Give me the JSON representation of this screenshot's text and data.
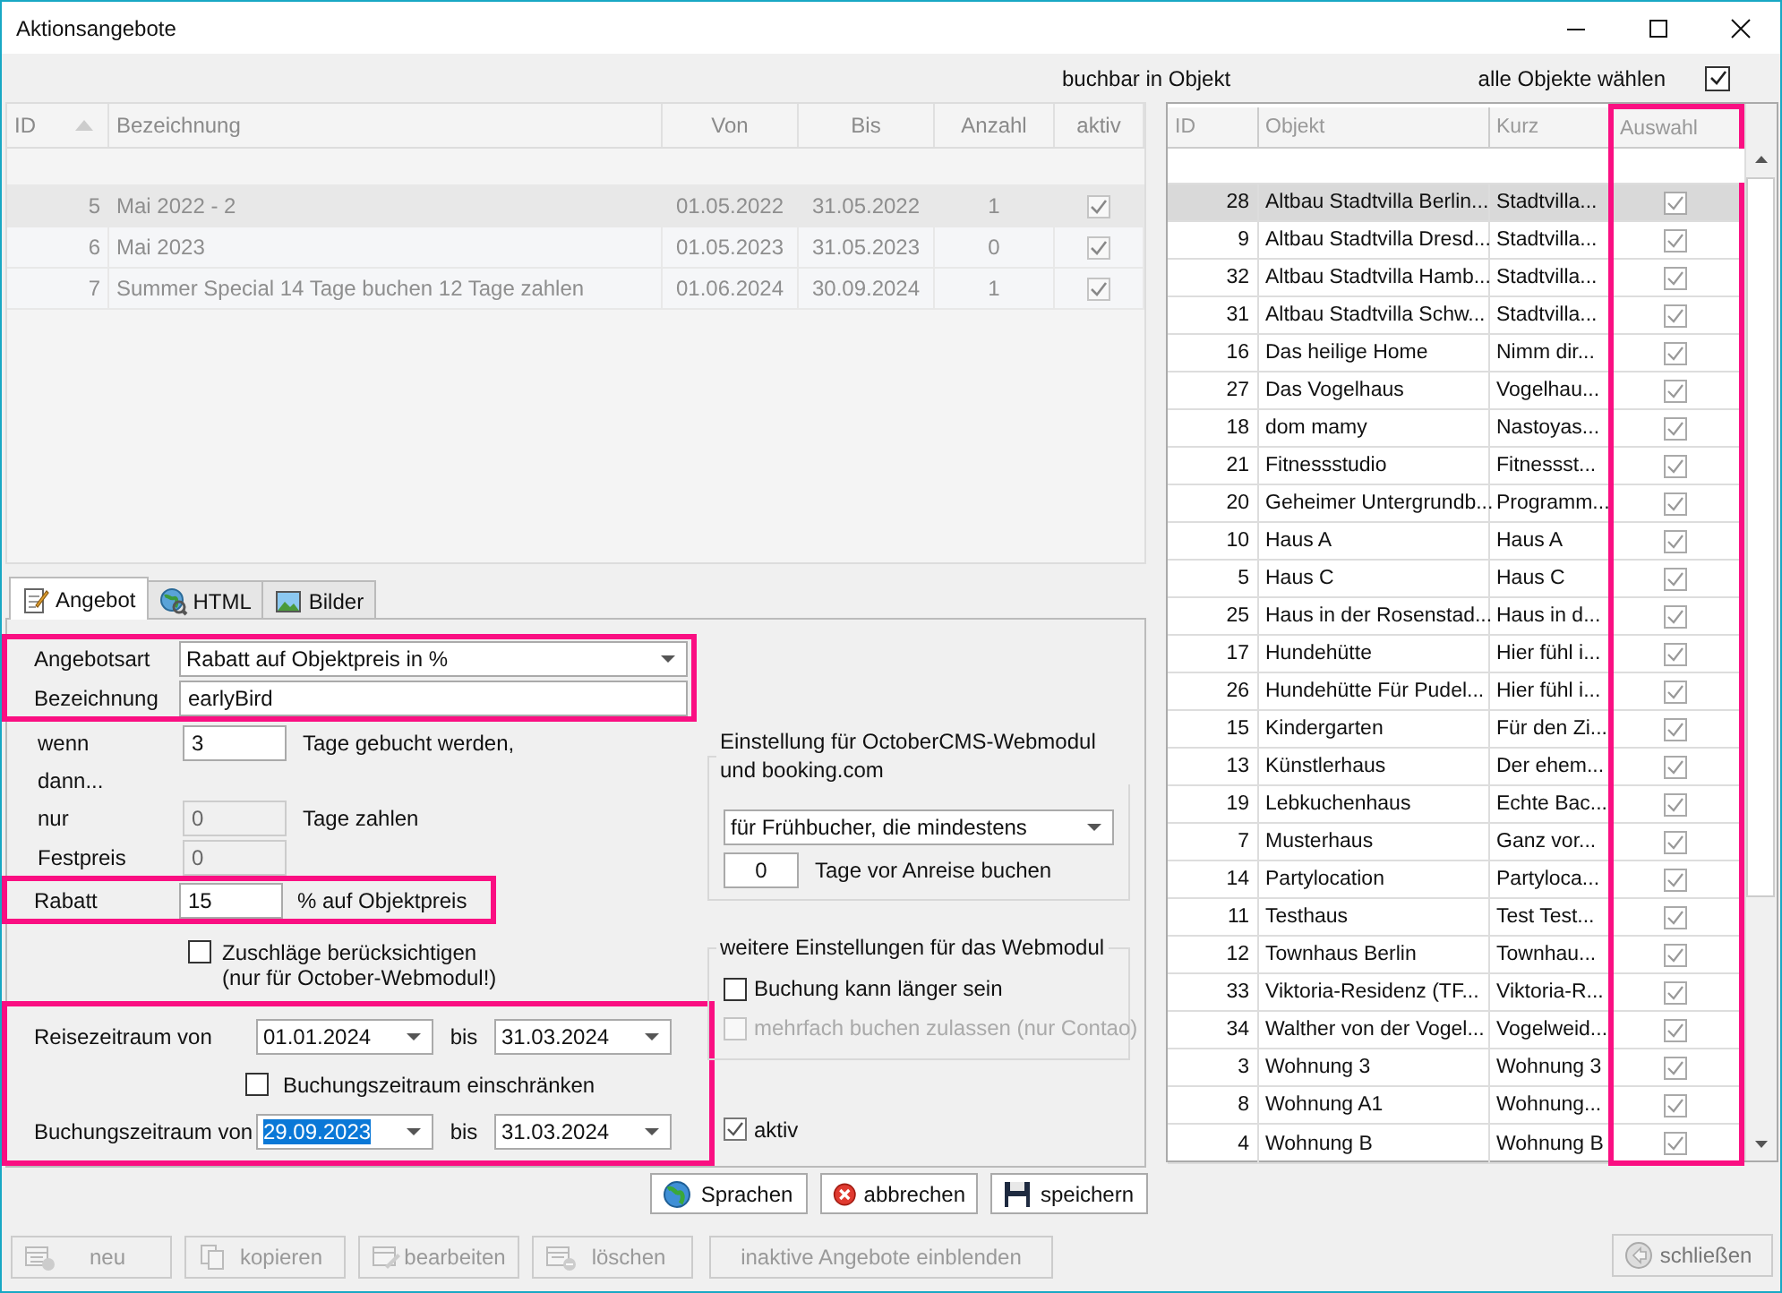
{
  "window": {
    "title": "Aktionsangebote"
  },
  "header": {
    "bookable_label": "buchbar in Objekt",
    "select_all": {
      "label": "alle Objekte wählen",
      "checked": true
    }
  },
  "offers_table": {
    "disabled": true,
    "columns": [
      {
        "label": "ID",
        "sorted": true
      },
      {
        "label": "Bezeichnung",
        "sorted": false
      },
      {
        "label": "Von",
        "sorted": false
      },
      {
        "label": "Bis",
        "sorted": false
      },
      {
        "label": "Anzahl",
        "sorted": false
      },
      {
        "label": "aktiv",
        "sorted": false
      }
    ],
    "rows": [
      {
        "id": "5",
        "name": "Mai 2022 - 2",
        "from": "01.05.2022",
        "to": "31.05.2022",
        "count": "1",
        "active": true,
        "selected": true
      },
      {
        "id": "6",
        "name": "Mai 2023",
        "from": "01.05.2023",
        "to": "31.05.2023",
        "count": "0",
        "active": true,
        "selected": false
      },
      {
        "id": "7",
        "name": "Summer Special 14 Tage buchen 12 Tage zahlen",
        "from": "01.06.2024",
        "to": "30.09.2024",
        "count": "1",
        "active": true,
        "selected": false
      }
    ]
  },
  "tabs": [
    {
      "label": "Angebot",
      "kind": "notepad",
      "selected": true
    },
    {
      "label": "HTML",
      "kind": "globe",
      "selected": false
    },
    {
      "label": "Bilder",
      "kind": "picture",
      "selected": false
    }
  ],
  "form": {
    "type_block": {
      "highlighted": true,
      "offer_type": {
        "label": "Angebotsart",
        "value": "Rabatt auf Objektpreis in %"
      },
      "name": {
        "label": "Bezeichnung",
        "value": "earlyBird"
      }
    },
    "when": {
      "label": "wenn",
      "value": "3",
      "suffix": "Tage gebucht werden,",
      "disabled": false
    },
    "then_label": "dann...",
    "only": {
      "label": "nur",
      "value": "0",
      "suffix": "Tage zahlen",
      "disabled": true
    },
    "fixed_price": {
      "label": "Festpreis",
      "value": "0",
      "disabled": true
    },
    "discount": {
      "highlighted": true,
      "label": "Rabatt",
      "value": "15",
      "suffix": "% auf Objektpreis"
    },
    "surcharges": {
      "label": "Zuschläge berücksichtigen",
      "note": "(nur für October-Webmodul!)",
      "checked": false
    },
    "periods": {
      "highlighted": true,
      "travel": {
        "label": "Reisezeitraum von",
        "from": "01.01.2024",
        "from_selected": false,
        "to_label": "bis",
        "to": "31.03.2024"
      },
      "restrict_booking": {
        "label": "Buchungszeitraum einschränken",
        "checked": false
      },
      "booking": {
        "label": "Buchungszeitraum von",
        "from": "29.09.2023",
        "from_selected": true,
        "to_label": "bis",
        "to": "31.03.2024"
      }
    },
    "october_group": {
      "title": "Einstellung für OctoberCMS-Webmodul und booking.com",
      "mode": "für Frühbucher, die mindestens",
      "days": "0",
      "days_label": "Tage vor Anreise buchen"
    },
    "webmodule_group": {
      "title": "weitere Einstellungen für das Webmodul",
      "options": [
        {
          "label": "Buchung kann länger sein",
          "checked": false,
          "disabled": false
        },
        {
          "label": "mehrfach buchen zulassen (nur Contao)",
          "checked": false,
          "disabled": true
        }
      ]
    },
    "active": {
      "label": "aktiv",
      "checked": true
    }
  },
  "dialog_buttons": [
    {
      "label": "Sprachen",
      "kind": "globe"
    },
    {
      "label": "abbrechen",
      "kind": "cancel"
    },
    {
      "label": "speichern",
      "kind": "save"
    }
  ],
  "toolbar": [
    {
      "label": "neu",
      "kind": "new",
      "disabled": true
    },
    {
      "label": "kopieren",
      "kind": "copy",
      "disabled": true
    },
    {
      "label": "bearbeiten",
      "kind": "edit",
      "disabled": true
    },
    {
      "label": "löschen",
      "kind": "delete",
      "disabled": true
    },
    {
      "label": "inaktive Angebote einblenden",
      "kind": "text",
      "disabled": true
    }
  ],
  "close_button": {
    "label": "schließen",
    "disabled": true
  },
  "objects_table": {
    "columns": [
      {
        "label": "ID",
        "highlighted": false
      },
      {
        "label": "Objekt",
        "highlighted": false
      },
      {
        "label": "Kurz",
        "highlighted": false
      },
      {
        "label": "Auswahl",
        "highlighted": true
      }
    ],
    "rows": [
      {
        "id": "28",
        "name": "Altbau Stadtvilla Berlin...",
        "short": "Stadtvilla...",
        "checked": true,
        "selected": true
      },
      {
        "id": "9",
        "name": "Altbau Stadtvilla Dresd...",
        "short": "Stadtvilla...",
        "checked": true,
        "selected": false
      },
      {
        "id": "32",
        "name": "Altbau Stadtvilla Hamb...",
        "short": "Stadtvilla...",
        "checked": true,
        "selected": false
      },
      {
        "id": "31",
        "name": "Altbau Stadtvilla Schw...",
        "short": "Stadtvilla...",
        "checked": true,
        "selected": false
      },
      {
        "id": "16",
        "name": "Das heilige Home",
        "short": "Nimm dir...",
        "checked": true,
        "selected": false
      },
      {
        "id": "27",
        "name": "Das Vogelhaus",
        "short": "Vogelhau...",
        "checked": true,
        "selected": false
      },
      {
        "id": "18",
        "name": "dom mamy",
        "short": "Nastoyas...",
        "checked": true,
        "selected": false
      },
      {
        "id": "21",
        "name": "Fitnessstudio",
        "short": "Fitnessst...",
        "checked": true,
        "selected": false
      },
      {
        "id": "20",
        "name": "Geheimer Untergrundb...",
        "short": "Programm...",
        "checked": true,
        "selected": false
      },
      {
        "id": "10",
        "name": "Haus A",
        "short": "Haus A",
        "checked": true,
        "selected": false
      },
      {
        "id": "5",
        "name": "Haus C",
        "short": "Haus C",
        "checked": true,
        "selected": false
      },
      {
        "id": "25",
        "name": "Haus in der Rosenstad...",
        "short": "Haus in d...",
        "checked": true,
        "selected": false
      },
      {
        "id": "17",
        "name": "Hundehütte",
        "short": "Hier fühl i...",
        "checked": true,
        "selected": false
      },
      {
        "id": "26",
        "name": "Hundehütte Für Pudel...",
        "short": "Hier fühl i...",
        "checked": true,
        "selected": false
      },
      {
        "id": "15",
        "name": "Kindergarten",
        "short": "Für den Zi...",
        "checked": true,
        "selected": false
      },
      {
        "id": "13",
        "name": "Künstlerhaus",
        "short": "Der ehem...",
        "checked": true,
        "selected": false
      },
      {
        "id": "19",
        "name": "Lebkuchenhaus",
        "short": "Echte Bac...",
        "checked": true,
        "selected": false
      },
      {
        "id": "7",
        "name": "Musterhaus",
        "short": "Ganz vor...",
        "checked": true,
        "selected": false
      },
      {
        "id": "14",
        "name": "Partylocation",
        "short": "Partyloca...",
        "checked": true,
        "selected": false
      },
      {
        "id": "11",
        "name": "Testhaus",
        "short": "Test Test...",
        "checked": true,
        "selected": false
      },
      {
        "id": "12",
        "name": "Townhaus Berlin",
        "short": "Townhau...",
        "checked": true,
        "selected": false
      },
      {
        "id": "33",
        "name": "Viktoria-Residenz (TF...",
        "short": "Viktoria-R...",
        "checked": true,
        "selected": false
      },
      {
        "id": "34",
        "name": "Walther von der Vogel...",
        "short": "Vogelweid...",
        "checked": true,
        "selected": false
      },
      {
        "id": "3",
        "name": "Wohnung 3",
        "short": "Wohnung 3",
        "checked": true,
        "selected": false
      },
      {
        "id": "8",
        "name": "Wohnung A1",
        "short": "Wohnung...",
        "checked": true,
        "selected": false
      },
      {
        "id": "4",
        "name": "Wohnung B",
        "short": "Wohnung B",
        "checked": true,
        "selected": false
      }
    ]
  }
}
